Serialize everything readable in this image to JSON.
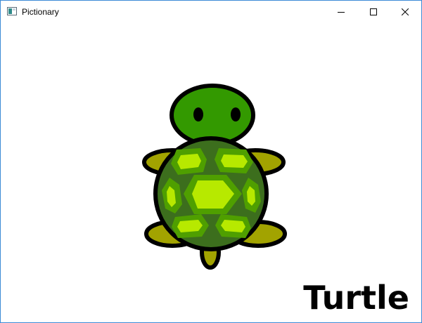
{
  "window": {
    "title": "Pictionary",
    "controls": {
      "minimize_icon": "minimize-icon",
      "maximize_icon": "maximize-icon",
      "close_icon": "close-icon"
    }
  },
  "drawing": {
    "subject": "turtle",
    "colors": {
      "outline": "#000000",
      "head": "#339900",
      "flippers": "#a2a300",
      "shell": "#3c6e1d",
      "scute_outer": "#4f9f00",
      "scute_inner": "#b7e900"
    }
  },
  "word": "Turtle"
}
